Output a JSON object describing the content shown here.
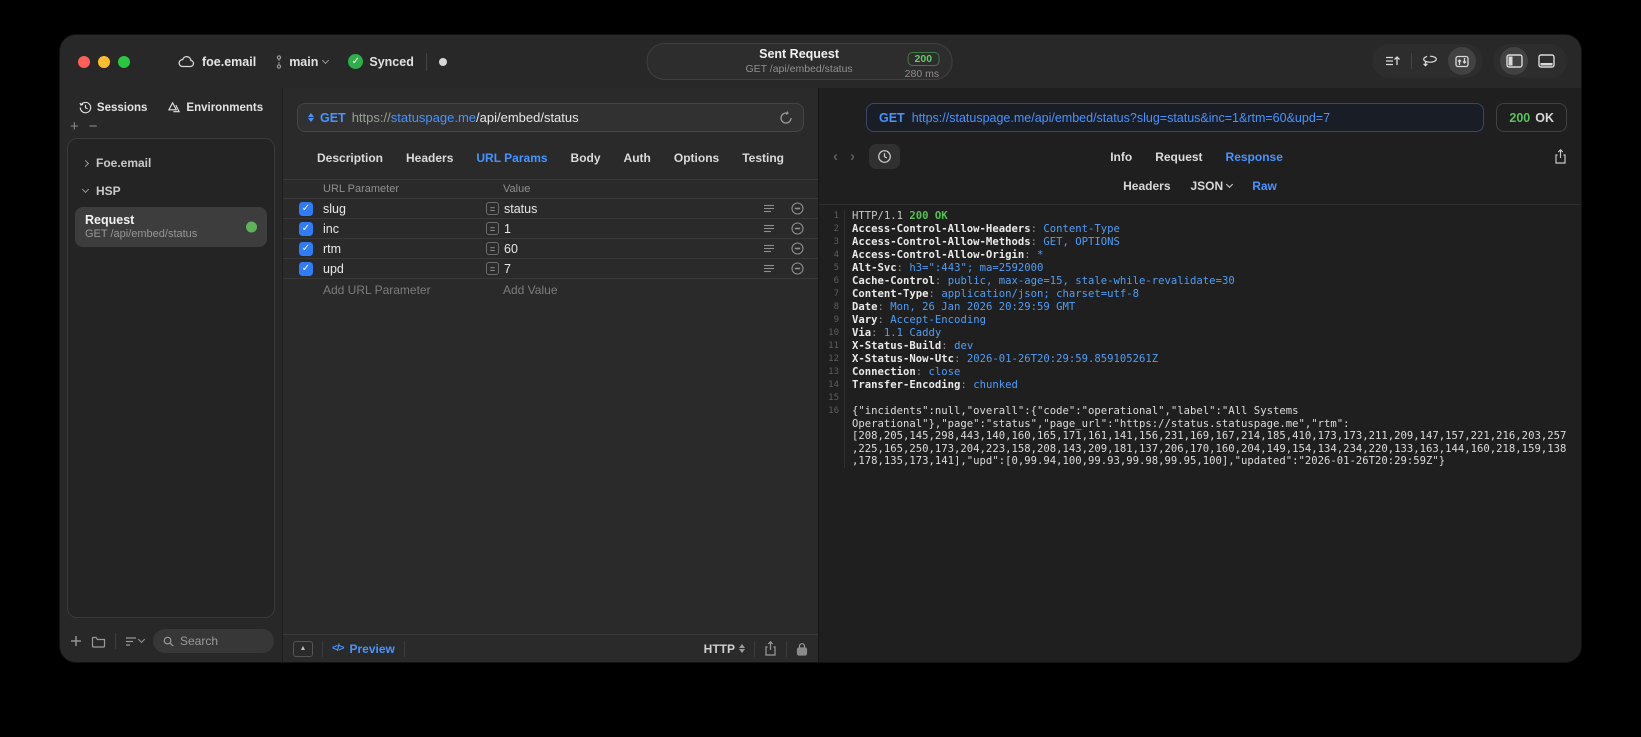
{
  "titlebar": {
    "project": "foe.email",
    "branch": "main",
    "sync_label": "Synced",
    "request_summary": {
      "title": "Sent Request",
      "subtitle": "GET /api/embed/status",
      "status_code": "200",
      "duration": "280 ms"
    }
  },
  "sidebar": {
    "tabs": [
      {
        "label": "Sessions"
      },
      {
        "label": "Environments"
      }
    ],
    "groups": [
      {
        "label": "Foe.email"
      },
      {
        "label": "HSP"
      }
    ],
    "selected_request": {
      "title": "Request",
      "subtitle": "GET /api/embed/status"
    },
    "search_placeholder": "Search"
  },
  "request_editor": {
    "method": "GET",
    "url": {
      "scheme": "https://",
      "host": "statuspage.me",
      "path": "/api/embed/status"
    },
    "tabs": [
      "Description",
      "Headers",
      "URL Params",
      "Body",
      "Auth",
      "Options",
      "Testing"
    ],
    "active_tab": "URL Params",
    "params": {
      "columns": [
        "URL Parameter",
        "Value"
      ],
      "rows": [
        {
          "enabled": true,
          "name": "slug",
          "value": "status"
        },
        {
          "enabled": true,
          "name": "inc",
          "value": "1"
        },
        {
          "enabled": true,
          "name": "rtm",
          "value": "60"
        },
        {
          "enabled": true,
          "name": "upd",
          "value": "7"
        }
      ],
      "add_name_placeholder": "Add URL Parameter",
      "add_value_placeholder": "Add Value"
    },
    "footer": {
      "preview_label": "Preview",
      "code_glyph": "</>",
      "protocol": "HTTP"
    }
  },
  "response_viewer": {
    "method": "GET",
    "url": "https://statuspage.me/api/embed/status?slug=status&inc=1&rtm=60&upd=7",
    "status_code": "200",
    "status_text": "OK",
    "tabs": [
      "Info",
      "Request",
      "Response"
    ],
    "active_tab": "Response",
    "subtabs": [
      {
        "label": "Headers"
      },
      {
        "label": "JSON",
        "dropdown": true
      },
      {
        "label": "Raw"
      }
    ],
    "active_subtab": "Raw",
    "body_lines": [
      {
        "n": "1",
        "parts": [
          {
            "t": "HTTP/1.1 ",
            "c": "plain"
          },
          {
            "t": "200 OK",
            "c": "green"
          }
        ]
      },
      {
        "n": "2",
        "parts": [
          {
            "t": "Access-Control-Allow-Headers",
            "c": "key"
          },
          {
            "t": ": ",
            "c": "dim"
          },
          {
            "t": "Content-Type",
            "c": "val"
          }
        ]
      },
      {
        "n": "3",
        "parts": [
          {
            "t": "Access-Control-Allow-Methods",
            "c": "key"
          },
          {
            "t": ": ",
            "c": "dim"
          },
          {
            "t": "GET, OPTIONS",
            "c": "val"
          }
        ]
      },
      {
        "n": "4",
        "parts": [
          {
            "t": "Access-Control-Allow-Origin",
            "c": "key"
          },
          {
            "t": ": ",
            "c": "dim"
          },
          {
            "t": "*",
            "c": "val"
          }
        ]
      },
      {
        "n": "5",
        "parts": [
          {
            "t": "Alt-Svc",
            "c": "key"
          },
          {
            "t": ": ",
            "c": "dim"
          },
          {
            "t": "h3=\":443\"; ma=2592000",
            "c": "val"
          }
        ]
      },
      {
        "n": "6",
        "parts": [
          {
            "t": "Cache-Control",
            "c": "key"
          },
          {
            "t": ": ",
            "c": "dim"
          },
          {
            "t": "public, max-age=15, stale-while-revalidate=30",
            "c": "val"
          }
        ]
      },
      {
        "n": "7",
        "parts": [
          {
            "t": "Content-Type",
            "c": "key"
          },
          {
            "t": ": ",
            "c": "dim"
          },
          {
            "t": "application/json; charset=utf-8",
            "c": "val"
          }
        ]
      },
      {
        "n": "8",
        "parts": [
          {
            "t": "Date",
            "c": "key"
          },
          {
            "t": ": ",
            "c": "dim"
          },
          {
            "t": "Mon, 26 Jan 2026 20:29:59 GMT",
            "c": "val"
          }
        ]
      },
      {
        "n": "9",
        "parts": [
          {
            "t": "Vary",
            "c": "key"
          },
          {
            "t": ": ",
            "c": "dim"
          },
          {
            "t": "Accept-Encoding",
            "c": "val"
          }
        ]
      },
      {
        "n": "10",
        "parts": [
          {
            "t": "Via",
            "c": "key"
          },
          {
            "t": ": ",
            "c": "dim"
          },
          {
            "t": "1.1 Caddy",
            "c": "val"
          }
        ]
      },
      {
        "n": "11",
        "parts": [
          {
            "t": "X-Status-Build",
            "c": "key"
          },
          {
            "t": ": ",
            "c": "dim"
          },
          {
            "t": "dev",
            "c": "val"
          }
        ]
      },
      {
        "n": "12",
        "parts": [
          {
            "t": "X-Status-Now-Utc",
            "c": "key"
          },
          {
            "t": ": ",
            "c": "dim"
          },
          {
            "t": "2026-01-26T20:29:59.859105261Z",
            "c": "val"
          }
        ]
      },
      {
        "n": "13",
        "parts": [
          {
            "t": "Connection",
            "c": "key"
          },
          {
            "t": ": ",
            "c": "dim"
          },
          {
            "t": "close",
            "c": "val"
          }
        ]
      },
      {
        "n": "14",
        "parts": [
          {
            "t": "Transfer-Encoding",
            "c": "key"
          },
          {
            "t": ": ",
            "c": "dim"
          },
          {
            "t": "chunked",
            "c": "val"
          }
        ]
      },
      {
        "n": "15",
        "parts": []
      },
      {
        "n": "16",
        "parts": [
          {
            "t": "{\"incidents\":null,\"overall\":{\"code\":\"operational\",\"label\":\"All Systems Operational\"},\"page\":\"status\",\"page_url\":\"https://status.statuspage.me\",\"rtm\":[208,205,145,298,443,140,160,165,171,161,141,156,231,169,167,214,185,410,173,173,211,209,147,157,221,216,203,257,225,165,250,173,204,223,158,208,143,209,181,137,206,170,160,204,149,154,134,234,220,133,163,144,160,218,159,138,178,135,173,141],\"upd\":[0,99.94,100,99.93,99.98,99.95,100],\"updated\":\"2026-01-26T20:29:59Z\"}",
            "c": "body"
          }
        ]
      }
    ]
  }
}
